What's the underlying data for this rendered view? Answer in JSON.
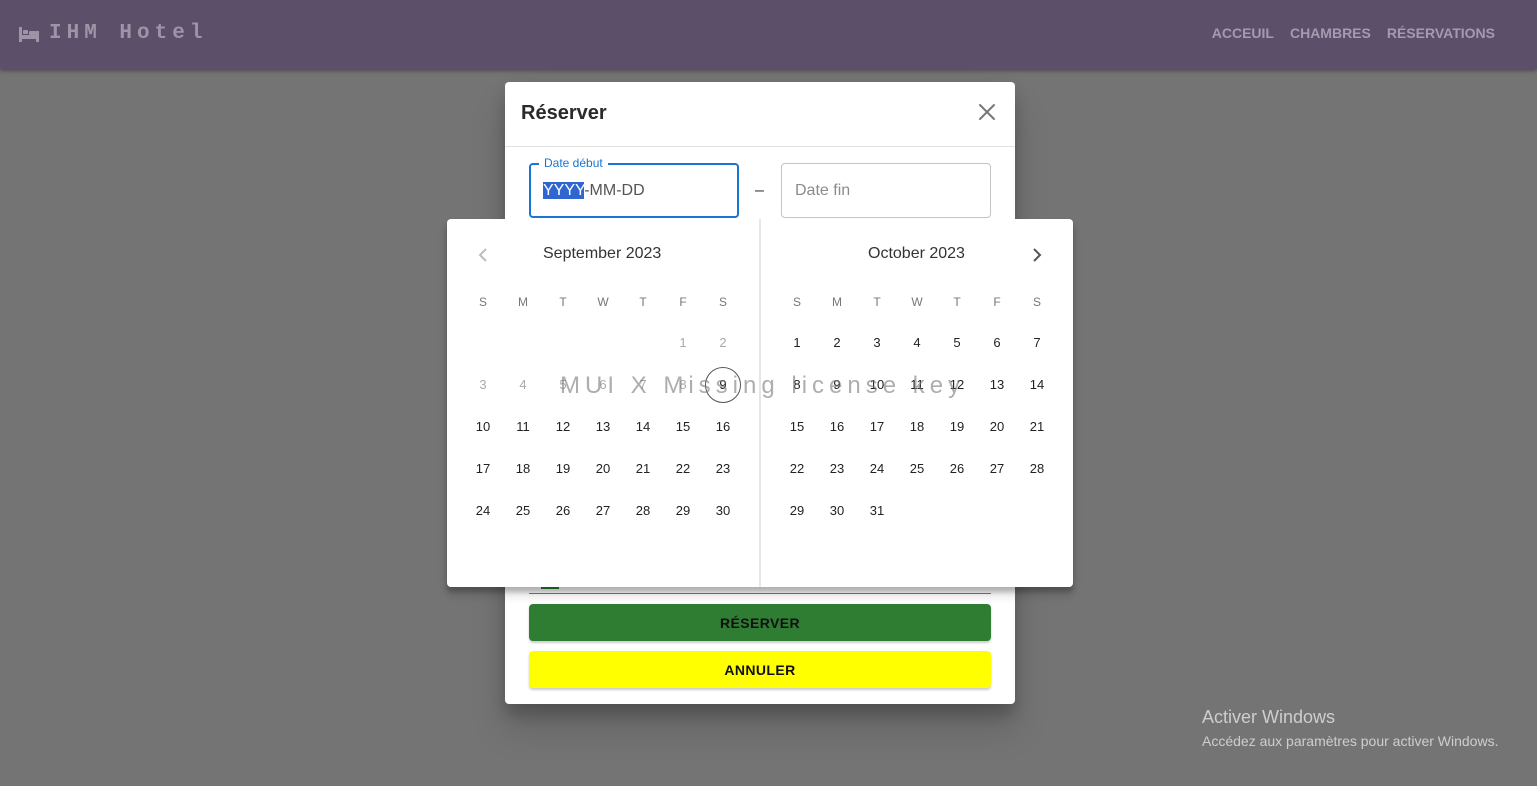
{
  "app": {
    "brand": "IHM Hotel",
    "brand_icon": "bed-icon",
    "nav": [
      "ACCEUIL",
      "CHAMBRES",
      "RÉSERVATIONS"
    ]
  },
  "dialog": {
    "title": "Réserver",
    "close_icon": "close-icon",
    "start_label": "Date début",
    "start_value_selected": "YYYY",
    "start_value_rest": "-MM-DD",
    "range_separator": "–",
    "end_placeholder": "Date fin",
    "reserve_label": "RÉSERVER",
    "cancel_label": "ANNULER"
  },
  "calendar": {
    "weekdays": [
      "S",
      "M",
      "T",
      "W",
      "T",
      "F",
      "S"
    ],
    "months": [
      {
        "title": "September 2023",
        "first_weekday": 5,
        "days": 30,
        "disabled_before": 9,
        "today": 9
      },
      {
        "title": "October 2023",
        "first_weekday": 0,
        "days": 31,
        "disabled_before": 0,
        "today": null
      }
    ],
    "prev_icon": "chevron-left-icon",
    "next_icon": "chevron-right-icon"
  },
  "watermark": "MUI X Missing license key",
  "windows": {
    "line1": "Activer Windows",
    "line2": "Accédez aux paramètres pour activer Windows."
  },
  "colors": {
    "appbar": "#5b4f69",
    "primary": "#1976d2",
    "reserve_button": "#2e7d32",
    "cancel_button": "#ffff00"
  }
}
